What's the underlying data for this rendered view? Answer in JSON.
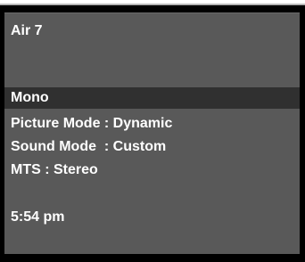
{
  "osd": {
    "channel": "Air 7",
    "audio_mode": "Mono",
    "picture_mode": "Picture Mode : Dynamic",
    "sound_mode": "Sound Mode  : Custom",
    "mts": "MTS : Stereo",
    "time": "5:54 pm"
  },
  "colors": {
    "background": "#595959",
    "highlight_row": "#303030",
    "text": "#ffffff",
    "frame": "#000000"
  }
}
